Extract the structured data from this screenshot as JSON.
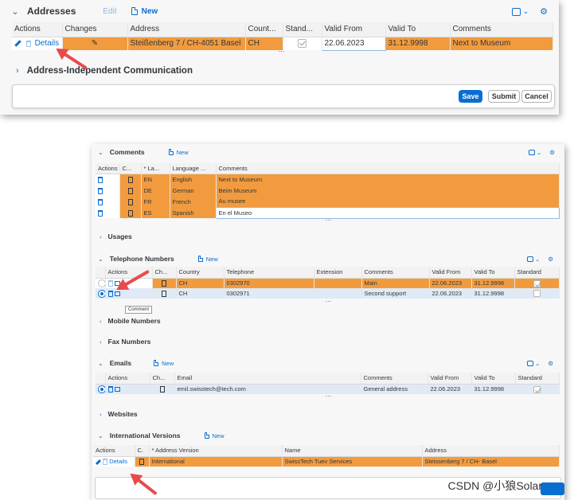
{
  "top": {
    "addresses": {
      "title": "Addresses",
      "edit": "Edit",
      "new": "New",
      "columns": [
        "Actions",
        "Changes",
        "Address",
        "Count...",
        "Stand...",
        "Valid From",
        "Valid To",
        "Comments"
      ],
      "row": {
        "action": "Details",
        "address": "Steißenberg 7 / CH-4051 Basel",
        "country": "CH",
        "standard": true,
        "valid_from": "22.06.2023",
        "valid_to": "31.12.9998",
        "comments": "Next to Museum"
      }
    },
    "aic": {
      "title": "Address-Independent Communication"
    },
    "footer": {
      "save": "Save",
      "submit": "Submit",
      "cancel": "Cancel"
    }
  },
  "bottom": {
    "comments": {
      "title": "Comments",
      "new": "New",
      "columns": [
        "Actions",
        "C...",
        "* La...",
        "Language ...",
        "Comments"
      ],
      "rows": [
        {
          "code": "EN",
          "language": "English",
          "comment": "Next to Museum"
        },
        {
          "code": "DE",
          "language": "German",
          "comment": "Beim Museum"
        },
        {
          "code": "FR",
          "language": "French",
          "comment": "Au musee"
        },
        {
          "code": "ES",
          "language": "Spanish",
          "comment": "En el Museo"
        }
      ]
    },
    "usages": {
      "title": "Usages"
    },
    "telephone": {
      "title": "Telephone Numbers",
      "new": "New",
      "columns": [
        "Actions",
        "Ch...",
        "Country",
        "Telephone",
        "Extension",
        "Comments",
        "Valid From",
        "Valid To",
        "Standard"
      ],
      "rows": [
        {
          "country": "CH",
          "telephone": "0302970",
          "extension": "",
          "comment": "Main",
          "valid_from": "22.06.2023",
          "valid_to": "31.12.9998"
        },
        {
          "country": "CH",
          "telephone": "0302971",
          "extension": "",
          "comment": "Second support",
          "valid_from": "22.06.2023",
          "valid_to": "31.12.9998"
        }
      ],
      "tooltip": "Comment"
    },
    "mobile": {
      "title": "Mobile Numbers"
    },
    "fax": {
      "title": "Fax Numbers"
    },
    "emails": {
      "title": "Emails",
      "new": "New",
      "columns": [
        "Actions",
        "Ch...",
        "Email",
        "Comments",
        "Valid From",
        "Valid To",
        "Standard"
      ],
      "row": {
        "email": "emil.swisstech@tech.com",
        "comment": "General address",
        "valid_from": "22.06.2023",
        "valid_to": "31.12.9998"
      }
    },
    "websites": {
      "title": "Websites"
    },
    "intl": {
      "title": "International Versions",
      "new": "New",
      "columns": [
        "Actions",
        "C.",
        "* Address Version",
        "Name",
        "Address"
      ],
      "row": {
        "action": "Details",
        "version": "International",
        "name": "SwissTech Tuev Services",
        "address": "Steissenberg 7 / CH- Basel"
      }
    }
  },
  "watermark": "CSDN @小狼Solar",
  "colors": {
    "accent": "#0a6ed1",
    "row_highlight": "#f29b3e",
    "annotation_arrow": "#e84b4b"
  }
}
